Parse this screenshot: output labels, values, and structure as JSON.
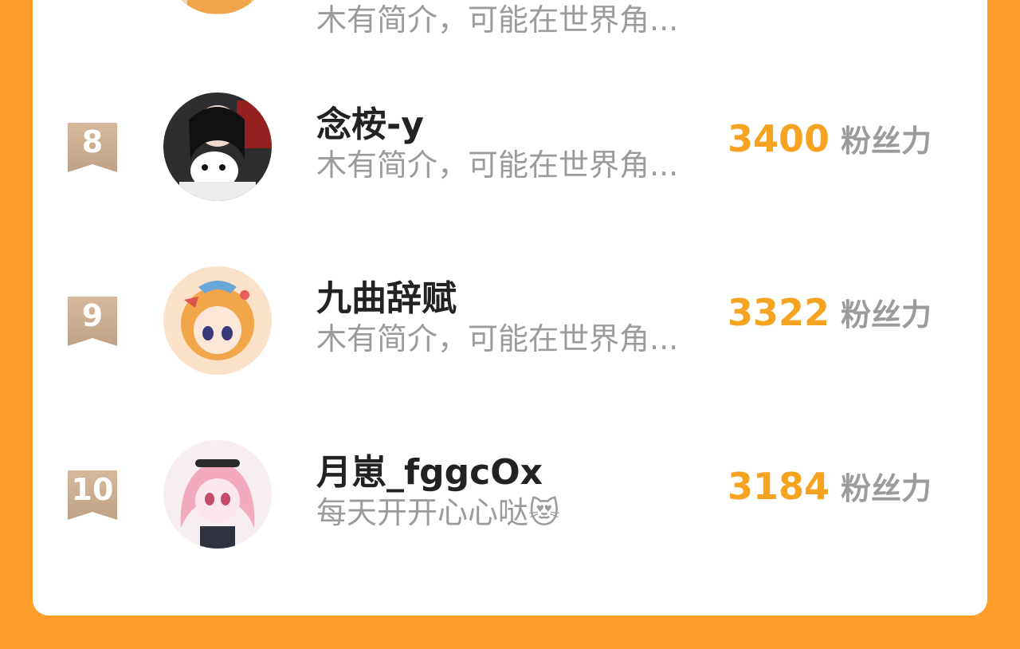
{
  "rows": [
    {
      "rank": "",
      "name": "",
      "bio": "木有简介，可能在世界角...",
      "fans_count": "",
      "fans_label": "",
      "avatar_icon": "avatar-icon"
    },
    {
      "rank": "8",
      "name": "念桉-y",
      "bio": "木有简介，可能在世界角...",
      "fans_count": "3400",
      "fans_label": "粉丝力",
      "avatar_icon": "avatar-icon"
    },
    {
      "rank": "9",
      "name": "九曲辞赋",
      "bio": "木有简介，可能在世界角...",
      "fans_count": "3322",
      "fans_label": "粉丝力",
      "avatar_icon": "avatar-icon"
    },
    {
      "rank": "10",
      "name": "月崽_fggcOx",
      "bio": "每天开开心心哒😻",
      "fans_count": "3184",
      "fans_label": "粉丝力",
      "avatar_icon": "avatar-icon"
    }
  ],
  "colors": {
    "background": "#FF9D2B",
    "card": "#ffffff",
    "fans_count": "#F5A321",
    "rank_badge_top": "#D7B89A",
    "rank_badge_bottom": "#BFA185"
  }
}
